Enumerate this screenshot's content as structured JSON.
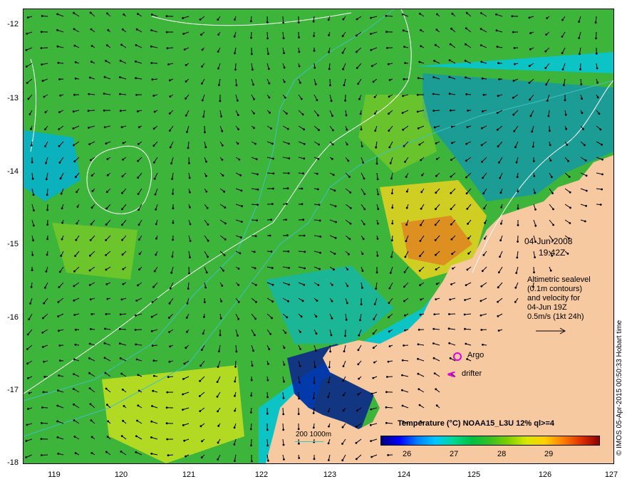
{
  "map": {
    "y_ticks": [
      "-12",
      "-13",
      "-14",
      "-15",
      "-16",
      "-17",
      "-18"
    ],
    "x_ticks": [
      "119",
      "120",
      "121",
      "122",
      "123",
      "124",
      "125",
      "126",
      "127"
    ],
    "bounds": {
      "lon_min": 118.6,
      "lon_max": 127.0,
      "lat_min": -18.0,
      "lat_max": -11.8
    }
  },
  "annotations": {
    "date": "04-Jun-2008",
    "time": "19:42Z",
    "altimetry_lines": [
      "Altimetric sealevel",
      "(0.1m contours)",
      "and velocity for",
      "04-Jun 19Z",
      "0.5m/s (1kt 24h)"
    ],
    "argo_label": "Argo",
    "drifter_label": "drifter",
    "scale_label": "200  1000m",
    "credit": "© IMOS 05-Apr-2015 00:50:33 Hobart time"
  },
  "colorbar": {
    "title": "Temperature (°C) NOAA15_L3U 12% ql>=4",
    "ticks": [
      "26",
      "27",
      "28",
      "29"
    ]
  },
  "colors": {
    "land": "#f7c9a0",
    "sea_main": "#3db43a",
    "warm": "#e0d020",
    "hot": "#e08020",
    "cool": "#00b8e8",
    "cold": "#0000a0",
    "bathymetry": "#40c0c0",
    "contour": "#ffffff",
    "marker": "#e000e0"
  }
}
